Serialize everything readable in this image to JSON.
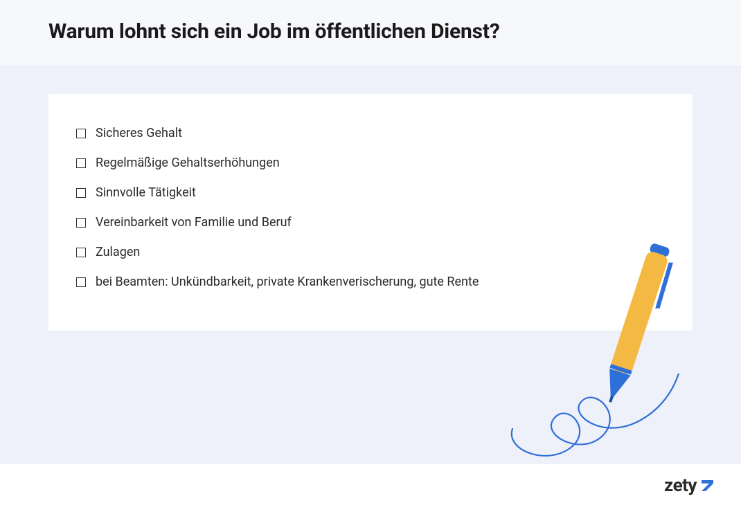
{
  "header": {
    "title": "Warum lohnt sich ein Job im öffentlichen Dienst?"
  },
  "items": [
    {
      "label": "Sicheres Gehalt"
    },
    {
      "label": "Regelmäßige Gehaltserhöhungen"
    },
    {
      "label": "Sinnvolle Tätigkeit"
    },
    {
      "label": "Vereinbarkeit von Familie und Beruf"
    },
    {
      "label": "Zulagen"
    },
    {
      "label": "bei Beamten: Unkündbarkeit, private Krankenverischerung, gute Rente"
    }
  ],
  "brand": {
    "name": "zety"
  },
  "colors": {
    "pen_body": "#f4b942",
    "pen_accent": "#2f6fd8",
    "squiggle": "#2f6fd8"
  }
}
